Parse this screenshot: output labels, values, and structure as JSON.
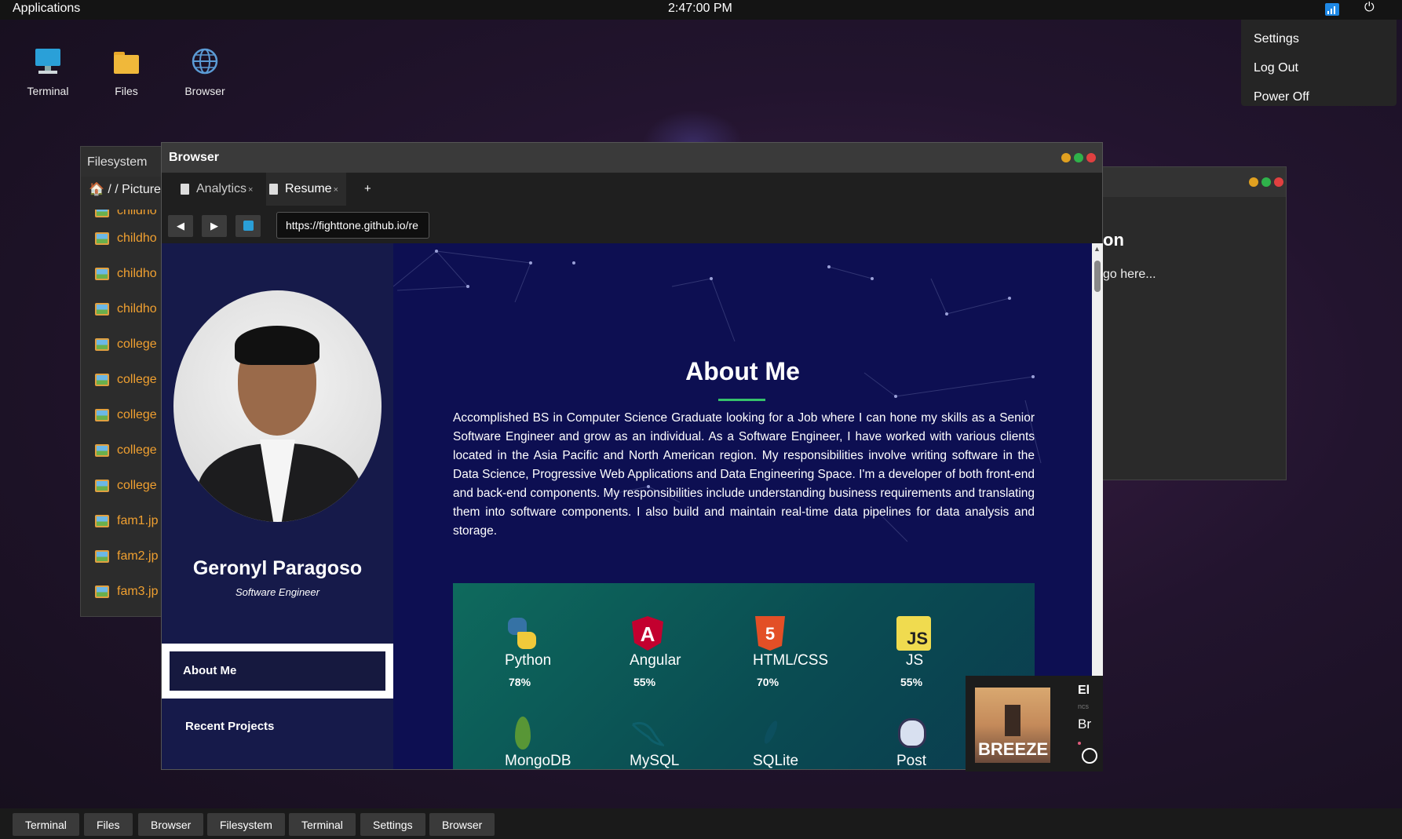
{
  "topbar": {
    "apps_label": "Applications",
    "clock": "2:47:00 PM"
  },
  "system_menu": {
    "items": [
      "Settings",
      "Log Out",
      "Power Off"
    ]
  },
  "desktop_icons": [
    {
      "label": "Terminal",
      "icon": "monitor-icon"
    },
    {
      "label": "Files",
      "icon": "folder-icon"
    },
    {
      "label": "Browser",
      "icon": "globe-icon"
    }
  ],
  "filesystem_window": {
    "title": "Filesystem",
    "path": "/ / Picture",
    "items": [
      "childho",
      "childho",
      "childho",
      "childho",
      "college",
      "college",
      "college",
      "college",
      "college",
      "fam1.jp",
      "fam2.jp",
      "fam3.jp"
    ]
  },
  "right_window": {
    "heading_fragment": "on",
    "text_fragment": "go here..."
  },
  "browser": {
    "title": "Browser",
    "tabs": [
      {
        "label": "Analytics",
        "close": "×"
      },
      {
        "label": "Resume",
        "close": "×"
      }
    ],
    "new_tab": "+",
    "url": "https://fighttone.github.io/re",
    "page": {
      "name": "Geronyl Paragoso",
      "role": "Software Engineer",
      "nav": [
        "About Me",
        "Recent Projects"
      ],
      "about_title": "About Me",
      "about_text": "Accomplished BS in Computer Science Graduate looking for a Job where I can hone my skills as a Senior Software Engineer and grow as an individual. As a Software Engineer, I have worked with various clients located in the Asia Pacific and North American region. My responsibilities involve writing software in the Data Science, Progressive Web Applications and Data Engineering Space. I'm a developer of both front-end and back-end components. My responsibilities include understanding business requirements and translating them into software components. I also build and maintain real-time data pipelines for data analysis and storage.",
      "skills": [
        {
          "label": "Python",
          "pct": "78%"
        },
        {
          "label": "Angular",
          "pct": "55%"
        },
        {
          "label": "HTML/CSS",
          "pct": "70%"
        },
        {
          "label": "JS",
          "pct": "55%"
        },
        {
          "label": "MongoDB",
          "pct": ""
        },
        {
          "label": "MySQL",
          "pct": ""
        },
        {
          "label": "SQLite",
          "pct": ""
        },
        {
          "label": "Post",
          "pct": ""
        }
      ]
    }
  },
  "player": {
    "cover_text": "BREEZE",
    "t1": "El",
    "t2": "ncs",
    "t3": "Br"
  },
  "taskbar": [
    "Terminal",
    "Files",
    "Browser",
    "Filesystem",
    "Terminal",
    "Settings",
    "Browser"
  ],
  "colors": {
    "accent_green": "#36c26b",
    "file_label": "#f0a030",
    "page_bg": "#0d0f52"
  }
}
